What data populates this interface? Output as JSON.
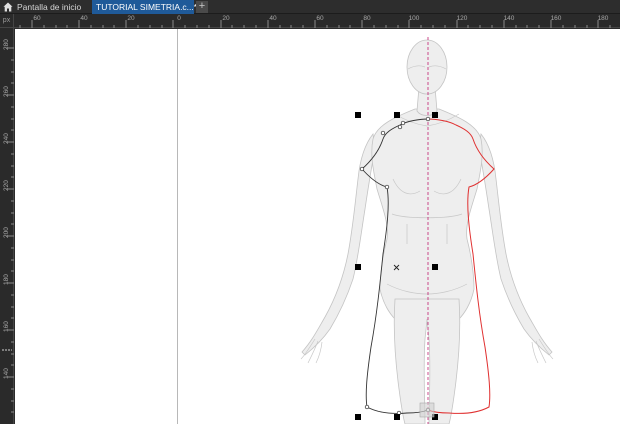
{
  "tabs": {
    "home_label": "Pantalla de inicio",
    "doc_label": "TUTORIAL SIMETRIA.c...*",
    "add_label": "+"
  },
  "ruler": {
    "corner_label": "px",
    "top_labels": [
      "60",
      "40",
      "20",
      "0",
      "20",
      "40",
      "60",
      "80",
      "100",
      "120",
      "140",
      "160",
      "180"
    ],
    "left_labels": [
      "280",
      "260",
      "240",
      "220",
      "200",
      "180",
      "160",
      "140"
    ]
  },
  "icons": [
    "home-icon"
  ],
  "colors": {
    "tab_active": "#1f5a99",
    "mirror_outline": "#e03030",
    "symmetry_axis": "#c02070",
    "selection_handle": "#000000"
  }
}
